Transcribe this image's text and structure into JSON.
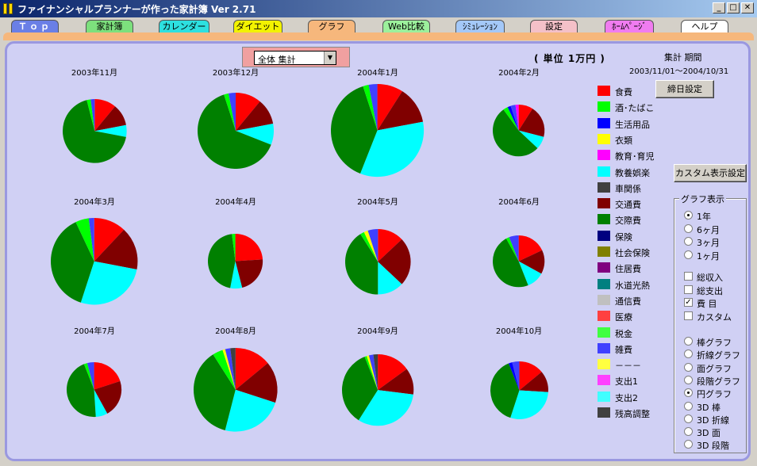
{
  "window": {
    "title": "ファイナンシャルプランナーが作った家計簿  Ver 2.71"
  },
  "tabs": [
    {
      "label": "Ｔｏｐ",
      "bg": "#6a7fe6",
      "fg": "#ffffff"
    },
    {
      "label": "家計簿",
      "bg": "#7de07d",
      "fg": "#000000"
    },
    {
      "label": "カレンダー",
      "bg": "#2de0e0",
      "fg": "#000000"
    },
    {
      "label": "ダイエット",
      "bg": "#f2f200",
      "fg": "#000000"
    },
    {
      "label": "グラフ",
      "bg": "#f6b77c",
      "fg": "#000000"
    },
    {
      "label": "Web比較",
      "bg": "#9cf09c",
      "fg": "#000000"
    },
    {
      "label": "ｼﾐｭﾚｰｼｮﾝ",
      "bg": "#a4c8f8",
      "fg": "#000000"
    },
    {
      "label": "設定",
      "bg": "#f4c0c8",
      "fg": "#000000"
    },
    {
      "label": "ﾎｰﾑﾍﾟｰｼﾞ",
      "bg": "#f07cf0",
      "fg": "#000000"
    },
    {
      "label": "ヘルプ",
      "bg": "#ffffff",
      "fg": "#000000"
    }
  ],
  "toolbar": {
    "dropdown_value": "全体 集計",
    "unit": "( 単位  1万円 )",
    "period_label": "集計 期間",
    "period_range": "2003/11/01～2004/10/31",
    "cutoff_button": "締日設定",
    "custom_button": "カスタム表示設定"
  },
  "chart_data": {
    "type": "pie",
    "categories": [
      "食費",
      "酒･たばこ",
      "生活用品",
      "衣類",
      "教育･育児",
      "教養娯楽",
      "車関係",
      "交通費",
      "交際費",
      "保険",
      "社会保険",
      "住居費",
      "水道光熱",
      "通信費",
      "医療",
      "税金",
      "雑費",
      "－－－",
      "支出1",
      "支出2",
      "残高調整"
    ],
    "colors": [
      "#ff0000",
      "#00ff00",
      "#0000ff",
      "#ffff00",
      "#ff00ff",
      "#00ffff",
      "#404040",
      "#800000",
      "#008000",
      "#000080",
      "#808000",
      "#800080",
      "#008080",
      "#c0c0c0",
      "#ff4040",
      "#40ff40",
      "#4040ff",
      "#ffff40",
      "#ff40ff",
      "#40ffff",
      "#404040"
    ],
    "series": [
      {
        "name": "2003年11月",
        "values": {
          "食費": 11,
          "交通費": 11,
          "教養娯楽": 6,
          "交際費": 68,
          "酒･たばこ": 2,
          "雑費": 2
        }
      },
      {
        "name": "2003年12月",
        "values": {
          "食費": 11,
          "交通費": 11,
          "教養娯楽": 9,
          "交際費": 64,
          "酒･たばこ": 2,
          "雑費": 3
        }
      },
      {
        "name": "2004年1月",
        "values": {
          "食費": 9,
          "交通費": 13,
          "教養娯楽": 34,
          "交際費": 39,
          "酒･たばこ": 2,
          "雑費": 3
        }
      },
      {
        "name": "2004年2月",
        "values": {
          "食費": 9,
          "交通費": 20,
          "教養娯楽": 8,
          "交際費": 53,
          "酒･たばこ": 3,
          "生活用品": 2,
          "雑費": 3,
          "教育･育児": 2
        }
      },
      {
        "name": "2004年3月",
        "values": {
          "食費": 12,
          "交通費": 16,
          "教養娯楽": 27,
          "交際費": 38,
          "酒･たばこ": 5,
          "雑費": 2
        }
      },
      {
        "name": "2004年4月",
        "values": {
          "食費": 24,
          "交通費": 22,
          "教養娯楽": 7,
          "交際費": 45,
          "酒･たばこ": 2
        }
      },
      {
        "name": "2004年5月",
        "values": {
          "食費": 13,
          "交通費": 24,
          "教養娯楽": 13,
          "交際費": 41,
          "酒･たばこ": 2,
          "衣類": 2,
          "雑費": 5
        }
      },
      {
        "name": "2004年6月",
        "values": {
          "食費": 18,
          "交通費": 15,
          "教養娯楽": 11,
          "交際費": 48,
          "酒･たばこ": 2,
          "雑費": 6
        }
      },
      {
        "name": "2004年7月",
        "values": {
          "食費": 20,
          "交通費": 22,
          "教養娯楽": 7,
          "交際費": 45,
          "酒･たばこ": 2,
          "雑費": 4
        }
      },
      {
        "name": "2004年8月",
        "values": {
          "食費": 14,
          "交通費": 16,
          "教養娯楽": 24,
          "交際費": 37,
          "酒･たばこ": 4,
          "衣類": 1,
          "雑費": 2,
          "残高調整": 2
        }
      },
      {
        "name": "2004年9月",
        "values": {
          "食費": 15,
          "交通費": 12,
          "教養娯楽": 32,
          "交際費": 35,
          "酒･たばこ": 1,
          "衣類": 1,
          "雑費": 2,
          "残高調整": 2
        }
      },
      {
        "name": "2004年10月",
        "values": {
          "食費": 14,
          "交通費": 12,
          "教養娯楽": 29,
          "交際費": 39,
          "生活用品": 2,
          "雑費": 4
        }
      }
    ],
    "scale": [
      0.84,
      1.0,
      1.22,
      0.68,
      1.14,
      0.72,
      0.86,
      0.68,
      0.72,
      1.1,
      0.94,
      0.76
    ],
    "legend_placement": "right"
  },
  "graph_options": {
    "title": "グラフ表示",
    "period": [
      {
        "label": "1年",
        "checked": true
      },
      {
        "label": "6ヶ月",
        "checked": false
      },
      {
        "label": "3ヶ月",
        "checked": false
      },
      {
        "label": "1ヶ月",
        "checked": false
      }
    ],
    "totals": [
      {
        "label": "総収入",
        "checked": false
      },
      {
        "label": "総支出",
        "checked": false
      },
      {
        "label": " 費 目",
        "checked": true
      },
      {
        "label": "カスタム",
        "checked": false
      }
    ],
    "types": [
      {
        "label": "棒グラフ",
        "checked": false
      },
      {
        "label": "折線グラフ",
        "checked": false
      },
      {
        "label": "面グラフ",
        "checked": false
      },
      {
        "label": "段階グラフ",
        "checked": false
      },
      {
        "label": "円グラフ",
        "checked": true
      },
      {
        "label": "3D 棒",
        "checked": false
      },
      {
        "label": "3D 折線",
        "checked": false
      },
      {
        "label": "3D 面",
        "checked": false
      },
      {
        "label": "3D 段階",
        "checked": false
      }
    ]
  }
}
